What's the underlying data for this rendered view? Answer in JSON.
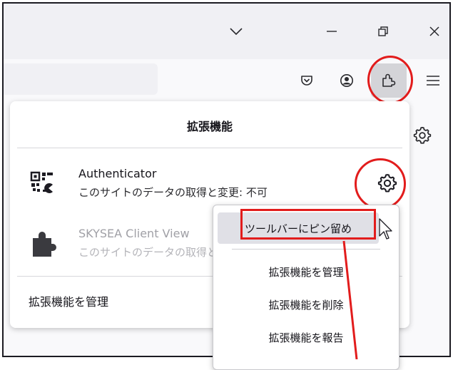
{
  "window": {
    "controls": {
      "chevron": "chevron-down-icon",
      "minimize": "minimize-icon",
      "restore": "restore-icon",
      "close": "close-icon"
    }
  },
  "toolbar": {
    "icons": [
      "pocket-icon",
      "account-icon",
      "extensions-icon",
      "menu-icon"
    ]
  },
  "panel": {
    "title": "拡張機能",
    "extensions": [
      {
        "name": "Authenticator",
        "status": "このサイトのデータの取得と変更: 不可",
        "icon": "qr-code-icon"
      },
      {
        "name": "SKYSEA Client View",
        "status": "このサイトのデータの取得と",
        "icon": "puzzle-icon"
      }
    ],
    "manage_label": "拡張機能を管理"
  },
  "context_menu": {
    "items": [
      "ツールバーにピン留め",
      "拡張機能を管理",
      "拡張機能を削除",
      "拡張機能を報告"
    ]
  },
  "colors": {
    "highlight": "#e21c1c",
    "panel_bg": "#ffffff",
    "toolbar_bg": "#f9f9fb",
    "titlebar_bg": "#f0f0f4"
  }
}
